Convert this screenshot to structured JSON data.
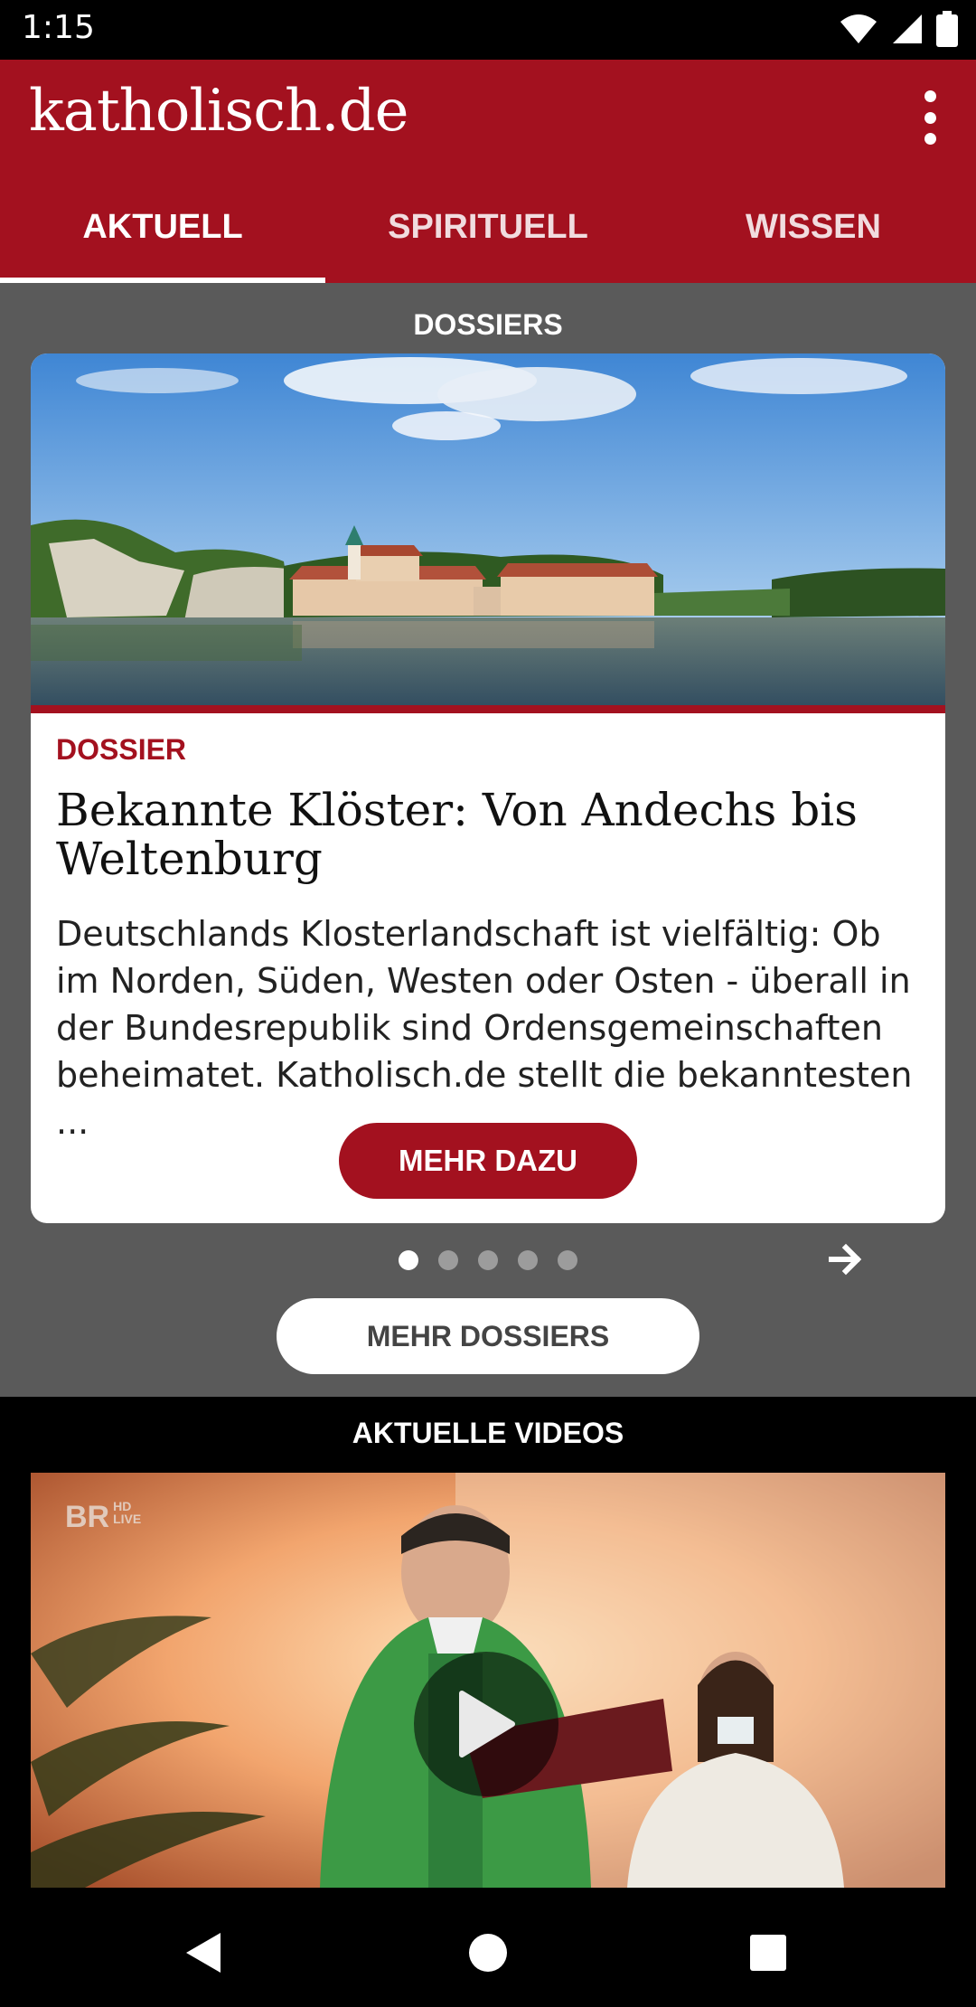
{
  "status_bar": {
    "time": "1:15",
    "icons": [
      "wifi-icon",
      "signal-icon",
      "battery-icon"
    ]
  },
  "app_bar": {
    "logo": "katholisch.de",
    "menu_icon": "more-vert-icon",
    "tabs": [
      {
        "label": "AKTUELL",
        "active": true
      },
      {
        "label": "SPIRITUELL",
        "active": false
      },
      {
        "label": "WISSEN",
        "active": false
      }
    ]
  },
  "dossiers": {
    "section_title": "DOSSIERS",
    "card": {
      "kicker": "DOSSIER",
      "title": "Bekannte Klöster: Von Andechs bis Weltenburg",
      "text": "Deutschlands Klosterlandschaft ist vielfältig: Ob im Norden, Süden, Westen oder Osten - überall in der Bundesrepublik sind Ordensgemeinschaften beheimatet. Katholisch.de stellt die bekanntesten ...",
      "button": "MEHR DAZU"
    },
    "pager": {
      "count": 5,
      "active_index": 0,
      "next_icon": "arrow-right-icon"
    },
    "more_button": "MEHR DOSSIERS"
  },
  "videos": {
    "section_title": "AKTUELLE VIDEOS",
    "channel_logo": "BR",
    "channel_tag_1": "HD",
    "channel_tag_2": "LIVE",
    "play_icon": "play-icon"
  },
  "colors": {
    "brand": "#a3111f",
    "section_bg": "#5a5a5a"
  }
}
